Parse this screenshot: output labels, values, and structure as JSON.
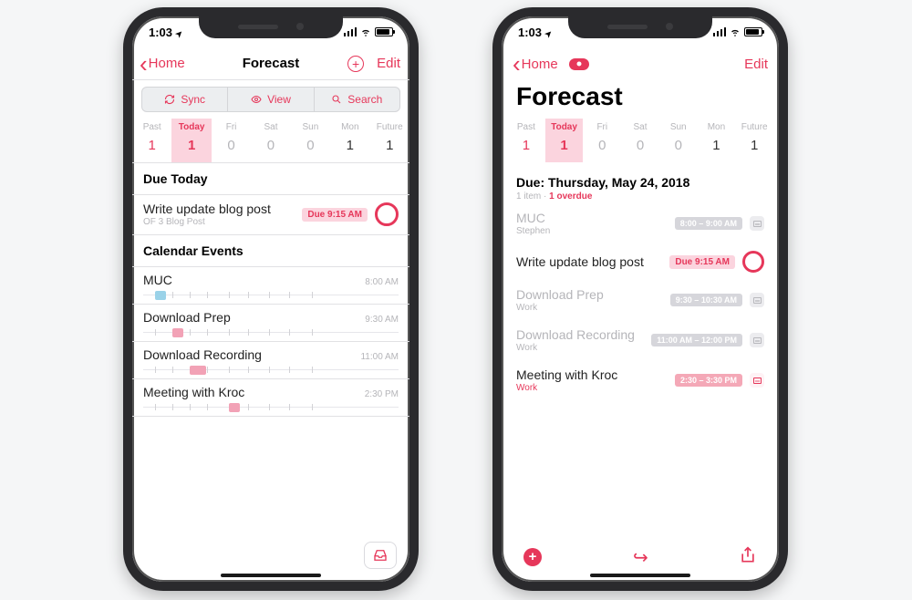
{
  "status": {
    "time": "1:03"
  },
  "left": {
    "back": "Home",
    "title": "Forecast",
    "edit": "Edit",
    "segments": {
      "sync": "Sync",
      "view": "View",
      "search": "Search"
    },
    "days": {
      "past": {
        "label": "Past",
        "count": "1"
      },
      "today": {
        "label": "Today",
        "count": "1"
      },
      "fri": {
        "label": "Fri",
        "count": "0"
      },
      "sat": {
        "label": "Sat",
        "count": "0"
      },
      "sun": {
        "label": "Sun",
        "count": "0"
      },
      "mon": {
        "label": "Mon",
        "count": "1"
      },
      "future": {
        "label": "Future",
        "count": "1"
      }
    },
    "due_section": "Due Today",
    "task": {
      "title": "Write update blog post",
      "project": "OF 3 Blog Post",
      "due": "Due 9:15 AM"
    },
    "cal_section": "Calendar Events",
    "events": [
      {
        "title": "MUC",
        "time": "8:00 AM",
        "color": "#9ad2e8",
        "start": 13,
        "width": 12
      },
      {
        "title": "Download Prep",
        "time": "9:30 AM",
        "color": "#f2a2b6",
        "start": 32,
        "width": 12
      },
      {
        "title": "Download Recording",
        "time": "11:00 AM",
        "color": "#f2a2b6",
        "start": 51,
        "width": 18
      },
      {
        "title": "Meeting with Kroc",
        "time": "2:30 PM",
        "color": "#f2a2b6",
        "start": 94,
        "width": 12
      }
    ]
  },
  "right": {
    "back": "Home",
    "edit": "Edit",
    "title": "Forecast",
    "days": {
      "past": {
        "label": "Past",
        "count": "1"
      },
      "today": {
        "label": "Today",
        "count": "1"
      },
      "fri": {
        "label": "Fri",
        "count": "0"
      },
      "sat": {
        "label": "Sat",
        "count": "0"
      },
      "sun": {
        "label": "Sun",
        "count": "0"
      },
      "mon": {
        "label": "Mon",
        "count": "1"
      },
      "future": {
        "label": "Future",
        "count": "1"
      }
    },
    "due_header": {
      "title": "Due: Thursday, May 24, 2018",
      "items": "1 item",
      "dot": "·",
      "overdue": "1 overdue"
    },
    "rows": [
      {
        "title": "MUC",
        "sub": "Stephen",
        "badge": "8:00 – 9:00 AM",
        "style": "grey-cal"
      },
      {
        "title": "Write update blog post",
        "badge": "Due 9:15 AM",
        "style": "task"
      },
      {
        "title": "Download Prep",
        "sub": "Work",
        "badge": "9:30 – 10:30 AM",
        "style": "grey-cal"
      },
      {
        "title": "Download Recording",
        "sub": "Work",
        "badge": "11:00 AM – 12:00 PM",
        "style": "grey-cal"
      },
      {
        "title": "Meeting with Kroc",
        "sub": "Work",
        "badge": "2:30 – 3:30 PM",
        "style": "accent-cal"
      }
    ]
  }
}
